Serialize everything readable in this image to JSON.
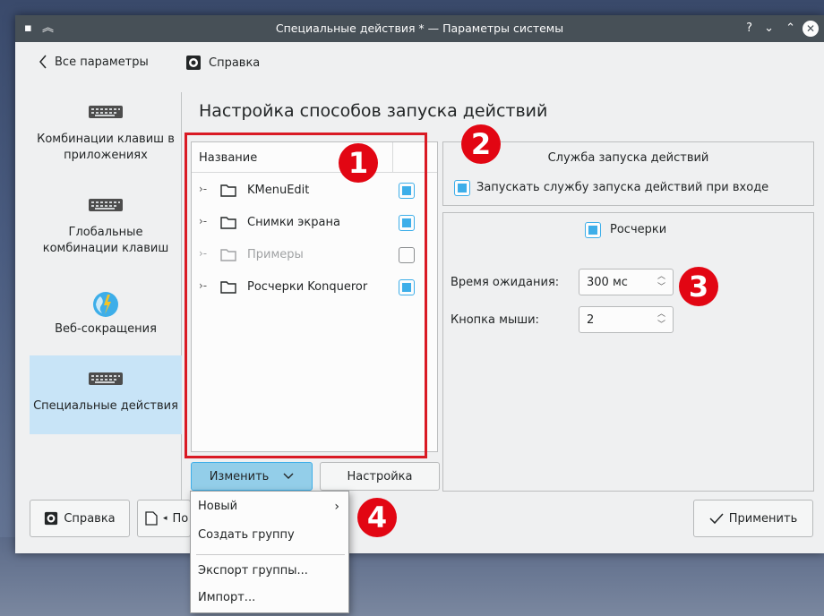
{
  "window": {
    "title": "Специальные действия * — Параметры системы",
    "help_glyph": "?"
  },
  "toolbar": {
    "back_label": "Все параметры",
    "help_label": "Справка"
  },
  "sidebar": {
    "items": [
      {
        "label": "Комбинации клавиш в приложениях",
        "icon": "keyboard-icon",
        "active": false
      },
      {
        "label": "Глобальные комбинации клавиш",
        "icon": "keyboard-icon",
        "active": false
      },
      {
        "label": "Веб-сокращения",
        "icon": "globe-icon",
        "active": false
      },
      {
        "label": "Специальные действия",
        "icon": "keyboard-icon",
        "active": true
      }
    ]
  },
  "main": {
    "title": "Настройка способов запуска действий",
    "tree": {
      "column_header": "Название",
      "rows": [
        {
          "label": "KMenuEdit",
          "checked": true,
          "enabled": true
        },
        {
          "label": "Снимки экрана",
          "checked": true,
          "enabled": true
        },
        {
          "label": "Примеры",
          "checked": false,
          "enabled": false
        },
        {
          "label": "Росчерки Konqueror",
          "checked": true,
          "enabled": true
        }
      ]
    },
    "edit_button": "Изменить",
    "settings_button": "Настройка",
    "service_group": {
      "title": "Служба запуска действий",
      "autostart_label": "Запускать службу запуска действий при входе",
      "autostart_checked": true
    },
    "gestures_group": {
      "title": "Росчерки",
      "enabled": true,
      "timeout_label": "Время ожидания:",
      "timeout_value": "300 мс",
      "mouse_button_label": "Кнопка мыши:",
      "mouse_button_value": "2"
    }
  },
  "bottom": {
    "help_label": "Справка",
    "defaults_label": "По",
    "apply_label": "Применить"
  },
  "menu": {
    "items": [
      "Новый",
      "Создать группу",
      "Экспорт группы...",
      "Импорт..."
    ]
  },
  "markers": [
    "1",
    "2",
    "3",
    "4"
  ],
  "colors": {
    "accent": "#3daee9",
    "marker": "#e20613",
    "titlebar": "#475057",
    "selection": "#c8e4f7"
  }
}
